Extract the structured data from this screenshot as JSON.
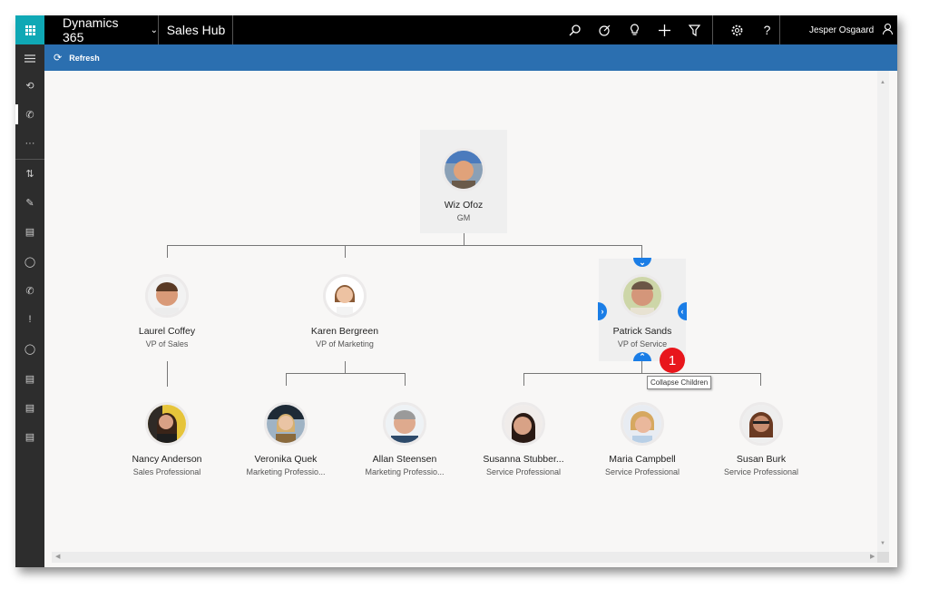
{
  "topbar": {
    "brand": "Dynamics 365",
    "app_name": "Sales Hub",
    "icons": [
      "search-icon",
      "task-icon",
      "lightbulb-icon",
      "plus-icon",
      "filter-icon",
      "gear-icon",
      "help-icon"
    ],
    "user_name": "Jesper Osgaard"
  },
  "command_bar": {
    "refresh_label": "Refresh"
  },
  "sidebar": {
    "items": [
      "recent",
      "activities",
      "more",
      "sales-item",
      "tasks",
      "notes",
      "contacts",
      "phone-calls",
      "cases",
      "leads",
      "documents",
      "reports",
      "documents-2"
    ]
  },
  "org_chart": {
    "root": {
      "name": "Wiz Ofoz",
      "title": "GM"
    },
    "level1": [
      {
        "name": "Laurel Coffey",
        "title": "VP of Sales"
      },
      {
        "name": "Karen Bergreen",
        "title": "VP of Marketing"
      },
      {
        "name": "Patrick Sands",
        "title": "VP of Service"
      }
    ],
    "level2": [
      {
        "name": "Nancy Anderson",
        "title": "Sales Professional"
      },
      {
        "name": "Veronika Quek",
        "title": "Marketing Professio..."
      },
      {
        "name": "Allan Steensen",
        "title": "Marketing Professio..."
      },
      {
        "name": "Susanna Stubber...",
        "title": "Service Professional"
      },
      {
        "name": "Maria Campbell",
        "title": "Service Professional"
      },
      {
        "name": "Susan Burk",
        "title": "Service Professional"
      }
    ]
  },
  "callout": {
    "number": "1",
    "tooltip": "Collapse Children"
  },
  "colors": {
    "accent": "#1a7de6",
    "command_bar": "#2b6fb0",
    "waffle": "#0fa8b5",
    "badge": "#e8161c"
  }
}
